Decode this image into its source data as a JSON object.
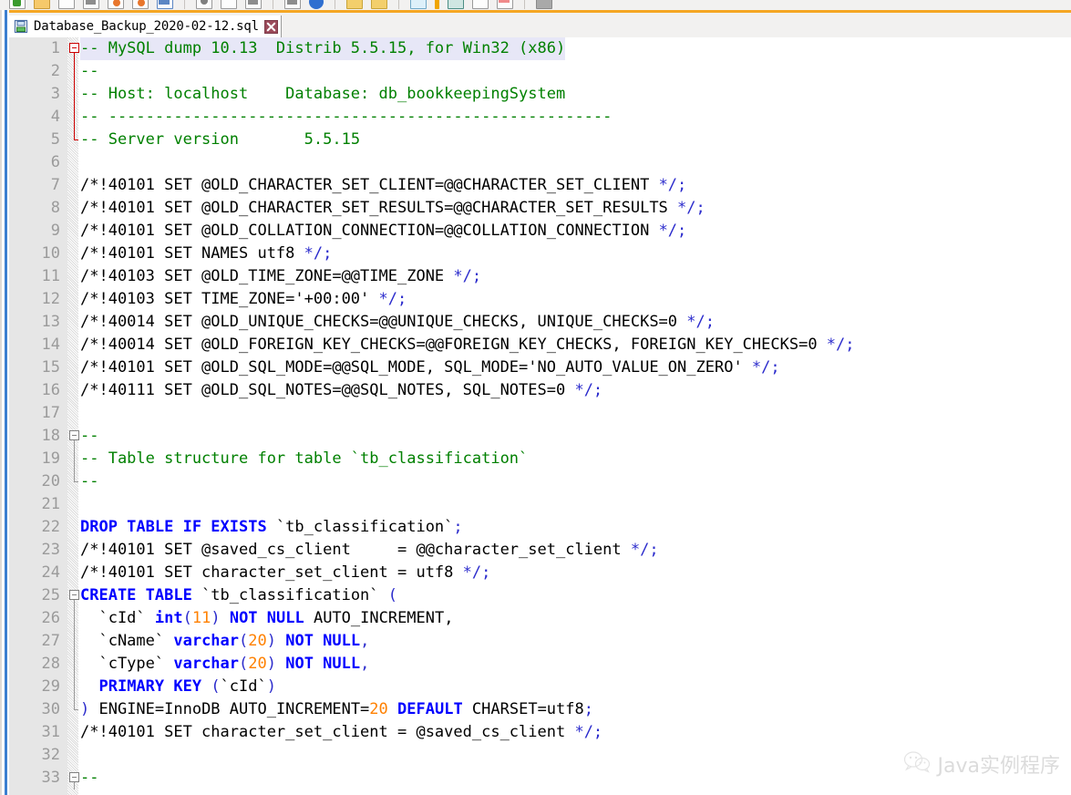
{
  "window": {
    "accent_color": "#f5a623",
    "gutter_color": "#e6e6e6",
    "current_line_color": "#e7e7f7"
  },
  "toolbar": {
    "description": "cropped toolbar strip",
    "icons": [
      "new-file-icon",
      "open-folder-icon",
      "save-icon",
      "save-all-icon",
      "close-icon",
      "print-icon",
      "cut-icon",
      "copy-icon",
      "paste-icon",
      "undo-icon",
      "redo-icon",
      "find-icon",
      "replace-icon",
      "zoom-in-icon",
      "zoom-out-icon",
      "sync-scroll-icon",
      "word-wrap-icon",
      "show-symbol-icon",
      "macro-record-icon",
      "run-icon"
    ]
  },
  "tab": {
    "label": "Database_Backup_2020-02-12.sql",
    "save_icon": "floppy-save-icon",
    "close_icon": "close-tab-icon",
    "close_glyph": "✖",
    "modified": false
  },
  "editor": {
    "language": "SQL",
    "first_visible_line": 1,
    "current_line": 1,
    "lines": [
      {
        "n": 1,
        "fold": "start-red",
        "current": true,
        "tokens": [
          {
            "t": "-- MySQL dump 10.13  Distrib 5.5.15, for Win32 (x86)",
            "c": "comment"
          }
        ]
      },
      {
        "n": 2,
        "fold": "body-red",
        "tokens": [
          {
            "t": "--",
            "c": "comment"
          }
        ]
      },
      {
        "n": 3,
        "fold": "body-red",
        "tokens": [
          {
            "t": "-- Host: localhost    Database: db_bookkeepingSystem",
            "c": "comment"
          }
        ]
      },
      {
        "n": 4,
        "fold": "body-red",
        "tokens": [
          {
            "t": "-- ------------------------------------------------------",
            "c": "comment"
          }
        ]
      },
      {
        "n": 5,
        "fold": "end-red",
        "tokens": [
          {
            "t": "-- Server version\t5.5.15",
            "c": "comment"
          }
        ]
      },
      {
        "n": 6,
        "fold": "none",
        "tokens": []
      },
      {
        "n": 7,
        "fold": "none",
        "tokens": [
          {
            "t": "/*!40101 SET @OLD_CHARACTER_SET_CLIENT=@@CHARACTER_SET_CLIENT ",
            "c": "plain"
          },
          {
            "t": "*/;",
            "c": "punct"
          }
        ]
      },
      {
        "n": 8,
        "fold": "none",
        "tokens": [
          {
            "t": "/*!40101 SET @OLD_CHARACTER_SET_RESULTS=@@CHARACTER_SET_RESULTS ",
            "c": "plain"
          },
          {
            "t": "*/;",
            "c": "punct"
          }
        ]
      },
      {
        "n": 9,
        "fold": "none",
        "tokens": [
          {
            "t": "/*!40101 SET @OLD_COLLATION_CONNECTION=@@COLLATION_CONNECTION ",
            "c": "plain"
          },
          {
            "t": "*/;",
            "c": "punct"
          }
        ]
      },
      {
        "n": 10,
        "fold": "none",
        "tokens": [
          {
            "t": "/*!40101 SET NAMES utf8 ",
            "c": "plain"
          },
          {
            "t": "*/;",
            "c": "punct"
          }
        ]
      },
      {
        "n": 11,
        "fold": "none",
        "tokens": [
          {
            "t": "/*!40103 SET @OLD_TIME_ZONE=@@TIME_ZONE ",
            "c": "plain"
          },
          {
            "t": "*/;",
            "c": "punct"
          }
        ]
      },
      {
        "n": 12,
        "fold": "none",
        "tokens": [
          {
            "t": "/*!40103 SET TIME_ZONE='+00:00' ",
            "c": "plain"
          },
          {
            "t": "*/;",
            "c": "punct"
          }
        ]
      },
      {
        "n": 13,
        "fold": "none",
        "tokens": [
          {
            "t": "/*!40014 SET @OLD_UNIQUE_CHECKS=@@UNIQUE_CHECKS, UNIQUE_CHECKS=0 ",
            "c": "plain"
          },
          {
            "t": "*/;",
            "c": "punct"
          }
        ]
      },
      {
        "n": 14,
        "fold": "none",
        "tokens": [
          {
            "t": "/*!40014 SET @OLD_FOREIGN_KEY_CHECKS=@@FOREIGN_KEY_CHECKS, FOREIGN_KEY_CHECKS=0 ",
            "c": "plain"
          },
          {
            "t": "*/;",
            "c": "punct"
          }
        ]
      },
      {
        "n": 15,
        "fold": "none",
        "tokens": [
          {
            "t": "/*!40101 SET @OLD_SQL_MODE=@@SQL_MODE, SQL_MODE='NO_AUTO_VALUE_ON_ZERO' ",
            "c": "plain"
          },
          {
            "t": "*/;",
            "c": "punct"
          }
        ]
      },
      {
        "n": 16,
        "fold": "none",
        "tokens": [
          {
            "t": "/*!40111 SET @OLD_SQL_NOTES=@@SQL_NOTES, SQL_NOTES=0 ",
            "c": "plain"
          },
          {
            "t": "*/;",
            "c": "punct"
          }
        ]
      },
      {
        "n": 17,
        "fold": "none",
        "tokens": []
      },
      {
        "n": 18,
        "fold": "start-gray",
        "tokens": [
          {
            "t": "--",
            "c": "comment"
          }
        ]
      },
      {
        "n": 19,
        "fold": "body-gray",
        "tokens": [
          {
            "t": "-- Table structure for table `tb_classification`",
            "c": "comment"
          }
        ]
      },
      {
        "n": 20,
        "fold": "end-gray",
        "tokens": [
          {
            "t": "--",
            "c": "comment"
          }
        ]
      },
      {
        "n": 21,
        "fold": "none",
        "tokens": []
      },
      {
        "n": 22,
        "fold": "none",
        "tokens": [
          {
            "t": "DROP TABLE IF EXISTS",
            "c": "kw"
          },
          {
            "t": " `tb_classification`",
            "c": "plain"
          },
          {
            "t": ";",
            "c": "punct"
          }
        ]
      },
      {
        "n": 23,
        "fold": "none",
        "tokens": [
          {
            "t": "/*!40101 SET @saved_cs_client     = @@character_set_client ",
            "c": "plain"
          },
          {
            "t": "*/;",
            "c": "punct"
          }
        ]
      },
      {
        "n": 24,
        "fold": "none",
        "tokens": [
          {
            "t": "/*!40101 SET character_set_client = utf8 ",
            "c": "plain"
          },
          {
            "t": "*/;",
            "c": "punct"
          }
        ]
      },
      {
        "n": 25,
        "fold": "start-gray",
        "tokens": [
          {
            "t": "CREATE TABLE",
            "c": "kw"
          },
          {
            "t": " `tb_classification` ",
            "c": "plain"
          },
          {
            "t": "(",
            "c": "punct"
          }
        ]
      },
      {
        "n": 26,
        "fold": "body-gray",
        "tokens": [
          {
            "t": "  `cId` ",
            "c": "plain"
          },
          {
            "t": "int",
            "c": "kw"
          },
          {
            "t": "(",
            "c": "punct"
          },
          {
            "t": "11",
            "c": "num"
          },
          {
            "t": ") ",
            "c": "punct"
          },
          {
            "t": "NOT NULL",
            "c": "kw"
          },
          {
            "t": " AUTO_INCREMENT,",
            "c": "plain"
          }
        ]
      },
      {
        "n": 27,
        "fold": "body-gray",
        "tokens": [
          {
            "t": "  `cName` ",
            "c": "plain"
          },
          {
            "t": "varchar",
            "c": "kw"
          },
          {
            "t": "(",
            "c": "punct"
          },
          {
            "t": "20",
            "c": "num"
          },
          {
            "t": ") ",
            "c": "punct"
          },
          {
            "t": "NOT NULL",
            "c": "kw"
          },
          {
            "t": ",",
            "c": "punct"
          }
        ]
      },
      {
        "n": 28,
        "fold": "body-gray",
        "tokens": [
          {
            "t": "  `cType` ",
            "c": "plain"
          },
          {
            "t": "varchar",
            "c": "kw"
          },
          {
            "t": "(",
            "c": "punct"
          },
          {
            "t": "20",
            "c": "num"
          },
          {
            "t": ") ",
            "c": "punct"
          },
          {
            "t": "NOT NULL",
            "c": "kw"
          },
          {
            "t": ",",
            "c": "punct"
          }
        ]
      },
      {
        "n": 29,
        "fold": "body-gray",
        "tokens": [
          {
            "t": "  ",
            "c": "plain"
          },
          {
            "t": "PRIMARY KEY",
            "c": "kw"
          },
          {
            "t": " (",
            "c": "punct"
          },
          {
            "t": "`cId`",
            "c": "plain"
          },
          {
            "t": ")",
            "c": "punct"
          }
        ]
      },
      {
        "n": 30,
        "fold": "end-gray",
        "tokens": [
          {
            "t": ")",
            "c": "punct"
          },
          {
            "t": " ENGINE=InnoDB AUTO_INCREMENT=",
            "c": "plain"
          },
          {
            "t": "20",
            "c": "num"
          },
          {
            "t": " ",
            "c": "plain"
          },
          {
            "t": "DEFAULT",
            "c": "kw"
          },
          {
            "t": " CHARSET=utf8",
            "c": "plain"
          },
          {
            "t": ";",
            "c": "punct"
          }
        ]
      },
      {
        "n": 31,
        "fold": "none",
        "tokens": [
          {
            "t": "/*!40101 SET character_set_client = @saved_cs_client ",
            "c": "plain"
          },
          {
            "t": "*/;",
            "c": "punct"
          }
        ]
      },
      {
        "n": 32,
        "fold": "none",
        "tokens": []
      },
      {
        "n": 33,
        "fold": "start-gray",
        "tokens": [
          {
            "t": "--",
            "c": "comment"
          }
        ]
      }
    ]
  },
  "watermark": {
    "text": "Java实例程序",
    "icon": "wechat-icon"
  }
}
